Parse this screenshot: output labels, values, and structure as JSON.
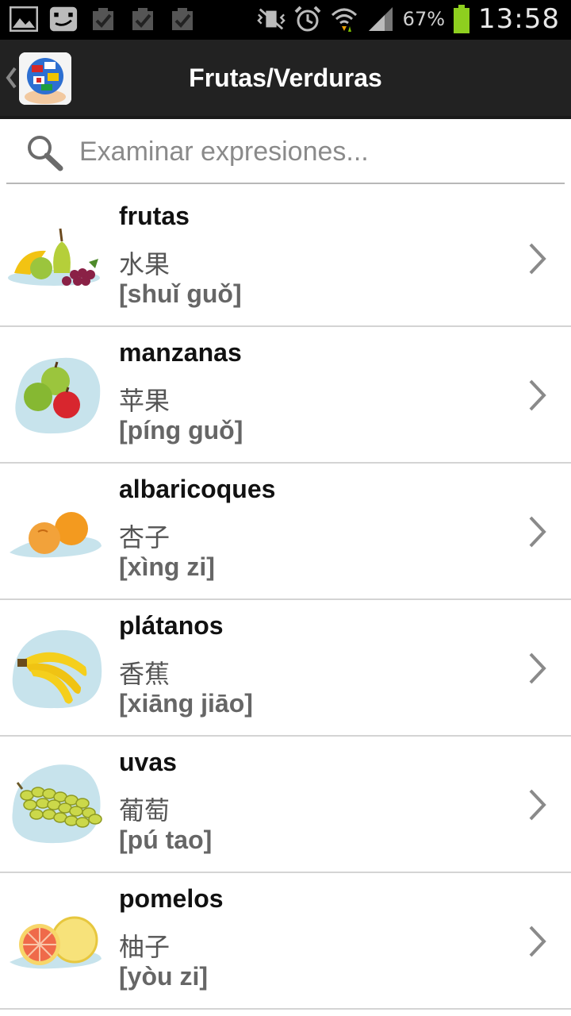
{
  "statusbar": {
    "battery_pct": "67%",
    "time": "13:58",
    "icons": [
      "gallery-icon",
      "chat-icon",
      "task-done-icon",
      "task-done-icon",
      "task-done-icon",
      "vibrate-mute-icon",
      "alarm-icon",
      "wifi-icon",
      "signal-icon",
      "battery-icon"
    ]
  },
  "actionbar": {
    "title": "Frutas/Verduras"
  },
  "search": {
    "placeholder": "Examinar expresiones..."
  },
  "items": [
    {
      "word": "frutas",
      "han": "水果",
      "pinyin": "[shuǐ guǒ]",
      "icon": "fruits-icon"
    },
    {
      "word": "manzanas",
      "han": "苹果",
      "pinyin": "[píng guǒ]",
      "icon": "apples-icon"
    },
    {
      "word": "albaricoques",
      "han": "杏子",
      "pinyin": "[xìng zi]",
      "icon": "apricots-icon"
    },
    {
      "word": "plátanos",
      "han": "香蕉",
      "pinyin": "[xiāng jiāo]",
      "icon": "bananas-icon"
    },
    {
      "word": "uvas",
      "han": "葡萄",
      "pinyin": "[pú tao]",
      "icon": "grapes-icon"
    },
    {
      "word": "pomelos",
      "han": "柚子",
      "pinyin": "[yòu zi]",
      "icon": "grapefruit-icon"
    }
  ]
}
